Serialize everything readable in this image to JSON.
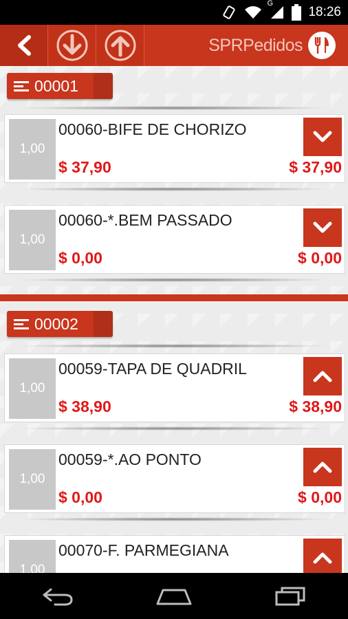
{
  "status_bar": {
    "time": "18:26",
    "network_label": "G"
  },
  "app_bar": {
    "brand": "SPRPedidos"
  },
  "groups": [
    {
      "number": "00001",
      "items": [
        {
          "qty": "1,00",
          "name": "00060-BIFE DE CHORIZO",
          "price": "$ 37,90",
          "total": "$ 37,90",
          "toggle": "expand"
        },
        {
          "qty": "1,00",
          "name": "00060-*.BEM PASSADO",
          "price": "$ 0,00",
          "total": "$ 0,00",
          "toggle": "expand"
        }
      ]
    },
    {
      "number": "00002",
      "items": [
        {
          "qty": "1,00",
          "name": "00059-TAPA DE QUADRIL",
          "price": "$ 38,90",
          "total": "$ 38,90",
          "toggle": "collapse"
        },
        {
          "qty": "1,00",
          "name": "00059-*.AO PONTO",
          "price": "$ 0,00",
          "total": "$ 0,00",
          "toggle": "collapse"
        },
        {
          "qty": "1,00",
          "name": "00070-F. PARMEGIANA",
          "price": "",
          "total": "",
          "toggle": "collapse"
        }
      ]
    }
  ],
  "icons": {
    "back": "back-arrow-icon",
    "download": "arrow-down-circle-icon",
    "upload": "arrow-up-circle-icon",
    "logo": "fork-knife-icon"
  },
  "colors": {
    "primary": "#c8361d",
    "price": "#e01818",
    "qty_bg": "#c8c8c8"
  }
}
